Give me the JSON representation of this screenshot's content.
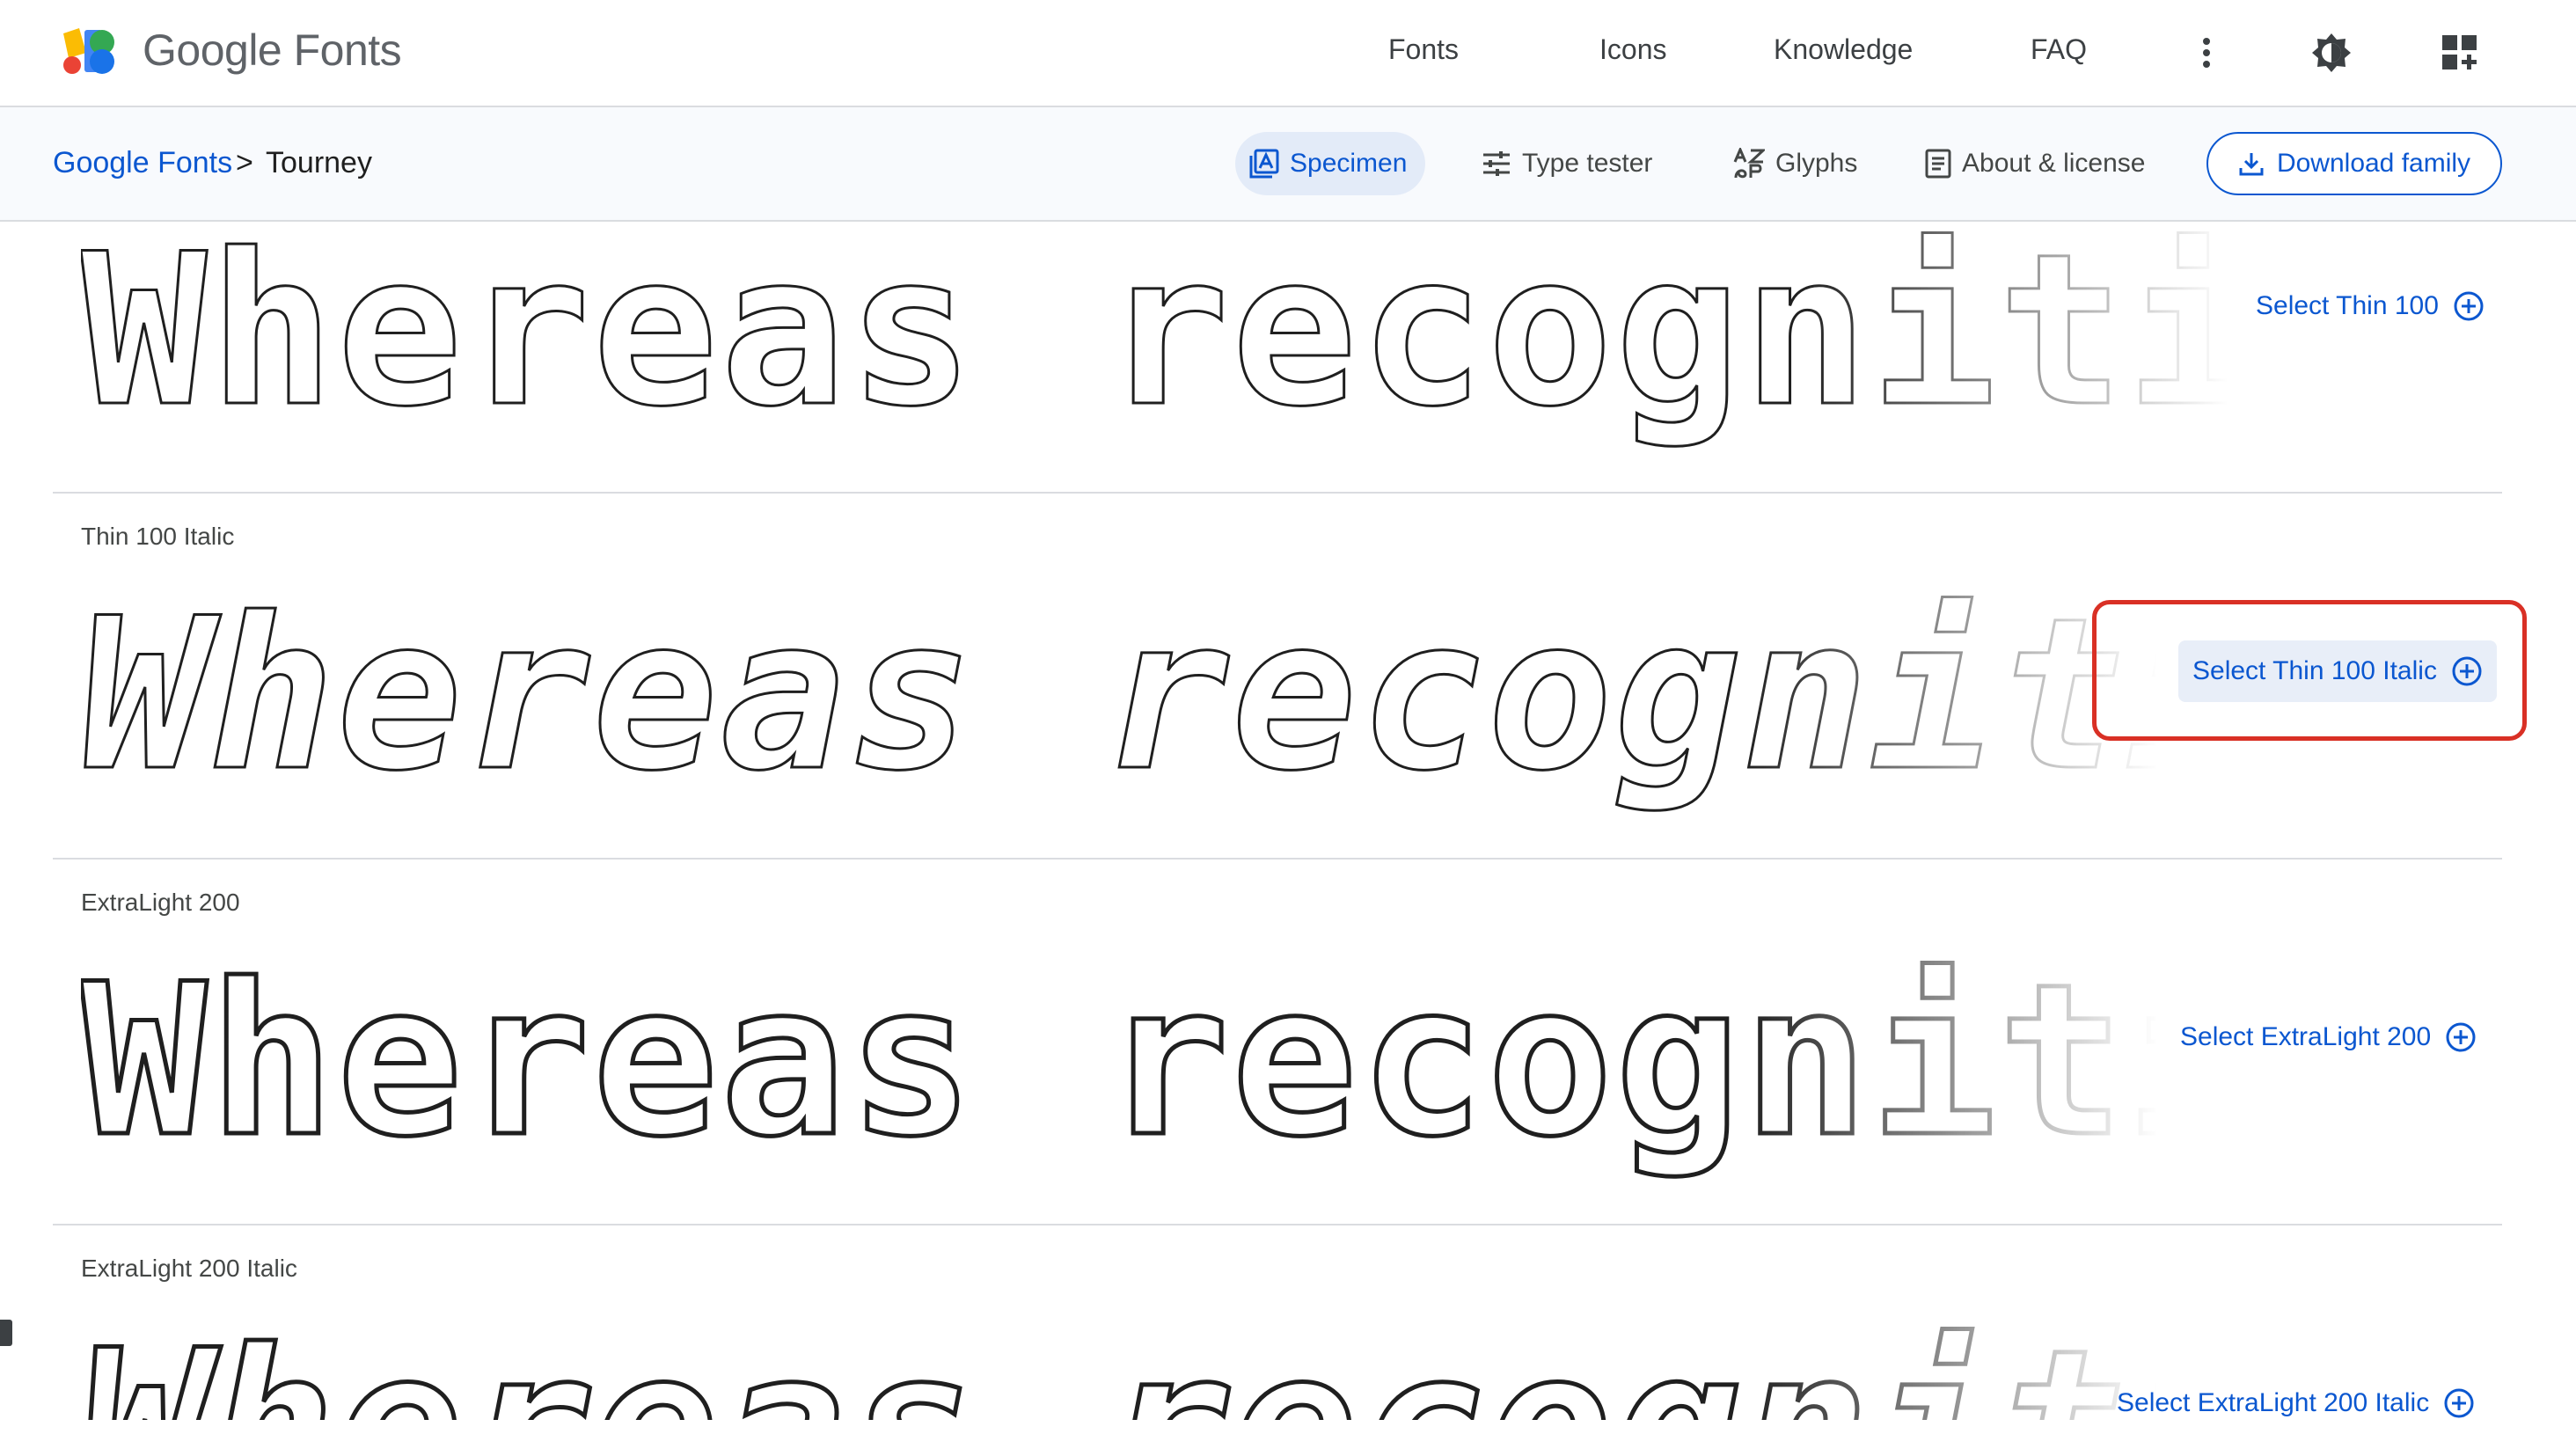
{
  "header": {
    "brand": "Google Fonts",
    "nav": [
      "Fonts",
      "Icons",
      "Knowledge",
      "FAQ"
    ],
    "icons": [
      "more-vert-icon",
      "theme-toggle-icon",
      "apps-grid-icon"
    ]
  },
  "subheader": {
    "breadcrumb": {
      "root": "Google Fonts",
      "separator": ">",
      "current": "Tourney"
    },
    "tabs": [
      {
        "label": "Specimen",
        "icon": "specimen-icon",
        "active": true
      },
      {
        "label": "Type tester",
        "icon": "tune-icon",
        "active": false
      },
      {
        "label": "Glyphs",
        "icon": "glyphs-icon",
        "active": false
      },
      {
        "label": "About & license",
        "icon": "article-icon",
        "active": false
      }
    ],
    "download_label": "Download family"
  },
  "styles": [
    {
      "label": "",
      "sample": "Whereas recognition",
      "select_label": "Select Thin 100"
    },
    {
      "label": "Thin 100 Italic",
      "sample": "Whereas recognition",
      "select_label": "Select Thin 100 Italic",
      "highlighted": true
    },
    {
      "label": "ExtraLight 200",
      "sample": "Whereas recognition",
      "select_label": "Select ExtraLight 200"
    },
    {
      "label": "ExtraLight 200 Italic",
      "sample": "Whereas recognition",
      "select_label": "Select ExtraLight 200 Italic"
    }
  ],
  "colors": {
    "accent": "#0b57d0",
    "highlight_box": "#d93025",
    "divider": "#dadce0"
  }
}
